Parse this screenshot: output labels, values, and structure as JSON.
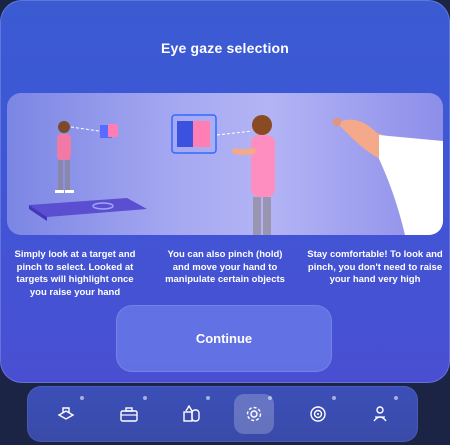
{
  "dialog": {
    "title": "Eye gaze selection",
    "captions": [
      "Simply look at a target and pinch to select. Looked at targets will highlight once you raise your hand",
      "You can also pinch (hold) and move your hand to manipulate certain objects",
      "Stay comfortable! To look and pinch, you don't need to raise your hand very high"
    ],
    "continue_label": "Continue"
  },
  "taskbar": {
    "icons": [
      {
        "name": "hologram-icon",
        "active": false
      },
      {
        "name": "toolbox-icon",
        "active": false
      },
      {
        "name": "objects-icon",
        "active": false
      },
      {
        "name": "settings-gear-icon",
        "active": true
      },
      {
        "name": "target-icon",
        "active": false
      },
      {
        "name": "person-icon",
        "active": false
      }
    ]
  },
  "colors": {
    "accent": "#3f56d6",
    "highlight_cube": "#ff6fa8"
  }
}
